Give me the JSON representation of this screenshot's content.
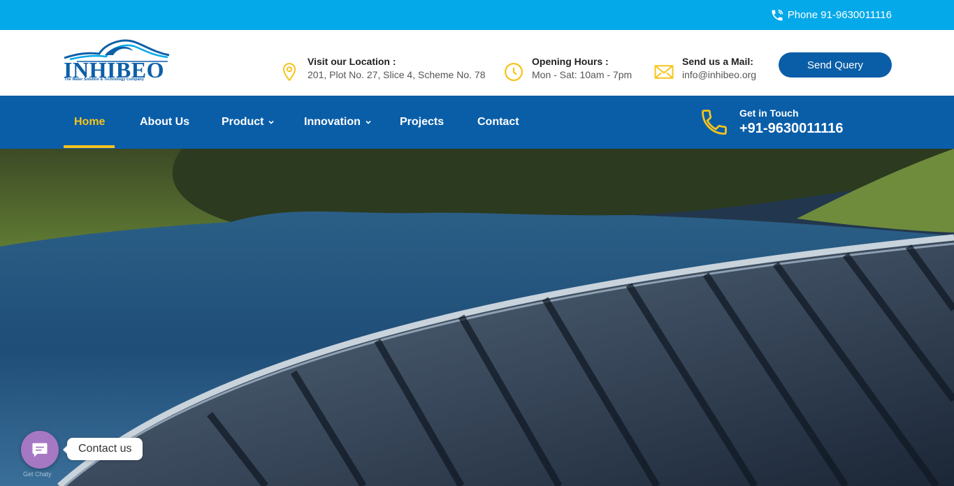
{
  "topbar": {
    "phone_label": "Phone 91-9630011116",
    "icon": "phone-icon"
  },
  "brand": {
    "name": "INHIBEO",
    "tagline": "The Water Solution & Technology Company",
    "color": "#0d5fa8"
  },
  "header": {
    "location": {
      "title": "Visit our Location :",
      "value": "201, Plot No. 27, Slice 4, Scheme No. 78",
      "icon": "location-pin-icon"
    },
    "hours": {
      "title": "Opening Hours :",
      "value": "Mon - Sat: 10am - 7pm",
      "icon": "clock-icon"
    },
    "mail": {
      "title": "Send us a Mail:",
      "value": "info@inhibeo.org",
      "icon": "envelope-icon"
    },
    "cta_label": "Send Query"
  },
  "nav": {
    "items": [
      {
        "label": "Home",
        "active": true
      },
      {
        "label": "About Us"
      },
      {
        "label": "Product",
        "dropdown": true
      },
      {
        "label": "Innovation",
        "dropdown": true
      },
      {
        "label": "Projects"
      },
      {
        "label": "Contact"
      }
    ],
    "get_in_touch": {
      "label": "Get in Touch",
      "phone": "+91-9630011116",
      "icon": "phone-icon"
    }
  },
  "chat": {
    "label": "Contact us",
    "credit": "Get Chaty",
    "icon": "chat-bubble-icon",
    "color": "#a678c4"
  },
  "colors": {
    "topbar": "#04a9e9",
    "nav": "#0a5ea8",
    "accent": "#f7c41b"
  }
}
